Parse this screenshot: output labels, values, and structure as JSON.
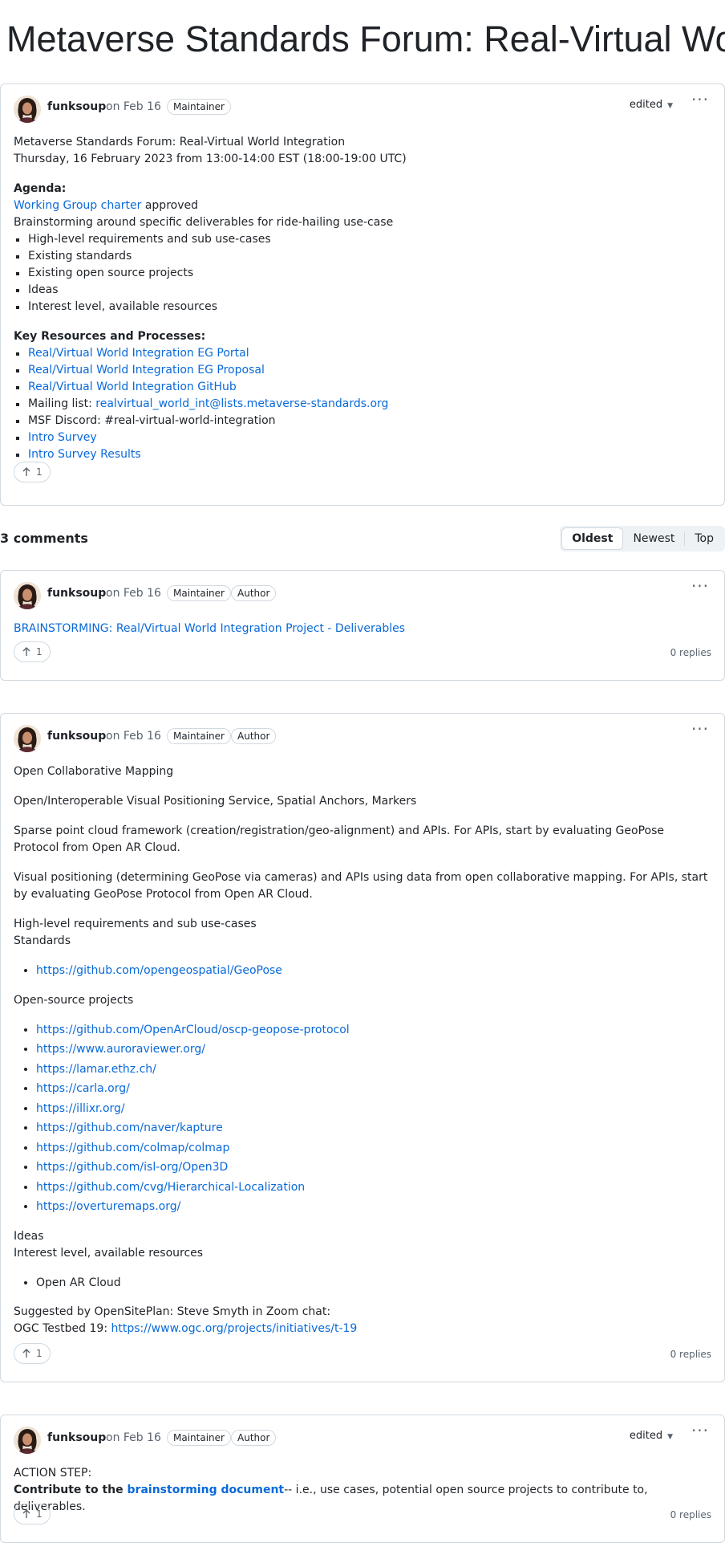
{
  "page_title": "Metaverse Standards Forum: Real-Virtual World",
  "colors": {
    "link": "#0969da",
    "muted": "#59636e",
    "border": "#d1d9e0",
    "text": "#1f2328"
  },
  "icons": {
    "upvote": "arrow-up-icon",
    "menu": "kebab-horizontal-icon",
    "edited_menu": "triangle-down-icon"
  },
  "post": {
    "author": "funksoup",
    "date": "on Feb 16",
    "badges": [
      "Maintainer"
    ],
    "edited_label": "edited",
    "line1": "Metaverse Standards Forum: Real-Virtual World Integration",
    "line2": "Thursday, 16 February 2023 from 13:00-14:00 EST (18:00-19:00 UTC)",
    "agenda_heading": "Agenda:",
    "charter_link": "Working Group charter",
    "charter_suffix": " approved",
    "brainstorm_line": "Brainstorming around specific deliverables for ride-hailing use-case",
    "agenda_items": [
      "High-level requirements and sub use-cases",
      "Existing standards",
      "Existing open source projects",
      "Ideas",
      "Interest level, available resources"
    ],
    "resources_heading": "Key Resources and Processes:",
    "resource_portal": "Real/Virtual World Integration EG Portal",
    "resource_proposal": "Real/Virtual World Integration EG Proposal",
    "resource_github": "Real/Virtual World Integration GitHub",
    "mailing_label": "Mailing list: ",
    "mailing_address": "realvirtual_world_int@lists.metaverse-standards.org",
    "discord_text": "MSF Discord: #real-virtual-world-integration",
    "survey": "Intro Survey",
    "survey_results": "Intro Survey Results",
    "upvotes": "1"
  },
  "comments_header": {
    "count_label": "3 comments",
    "sort_options": [
      "Oldest",
      "Newest",
      "Top"
    ],
    "active_sort": "Oldest"
  },
  "comment1": {
    "author": "funksoup",
    "date": "on Feb 16",
    "badges": [
      "Maintainer",
      "Author"
    ],
    "link_text": "BRAINSTORMING: Real/Virtual World Integration Project - Deliverables",
    "upvotes": "1",
    "replies": "0 replies"
  },
  "comment2": {
    "author": "funksoup",
    "date": "on Feb 16",
    "badges": [
      "Maintainer",
      "Author"
    ],
    "p1": "Open Collaborative Mapping",
    "p2": "Open/Interoperable Visual Positioning Service, Spatial Anchors, Markers",
    "p3": "Sparse point cloud framework (creation/registration/geo-alignment) and APIs. For APIs, start by evaluating GeoPose Protocol from Open AR Cloud.",
    "p4": "Visual positioning (determining GeoPose via cameras) and APIs using data from open collaborative mapping. For APIs, start by evaluating GeoPose Protocol from Open AR Cloud.",
    "p5a": "High-level requirements and sub use-cases",
    "p5b": "Standards",
    "standards_links": [
      "https://github.com/opengeospatial/GeoPose"
    ],
    "oss_heading": "Open-source projects",
    "oss_links": [
      "https://github.com/OpenArCloud/oscp-geopose-protocol",
      "https://www.auroraviewer.org/",
      "https://lamar.ethz.ch/",
      "https://carla.org/",
      "https://illixr.org/",
      "https://github.com/naver/kapture",
      "https://github.com/colmap/colmap",
      "https://github.com/isl-org/Open3D",
      "https://github.com/cvg/Hierarchical-Localization",
      "https://overturemaps.org/"
    ],
    "ideas": "Ideas",
    "interest": "Interest level, available resources",
    "interest_items": [
      "Open AR Cloud"
    ],
    "suggested": "Suggested by OpenSitePlan: Steve Smyth in Zoom chat:",
    "testbed_label": "OGC Testbed 19: ",
    "testbed_link": "https://www.ogc.org/projects/initiatives/t-19",
    "upvotes": "1",
    "replies": "0 replies"
  },
  "comment3": {
    "author": "funksoup",
    "date": "on Feb 16",
    "badges": [
      "Maintainer",
      "Author"
    ],
    "edited_label": "edited",
    "action_label": "ACTION STEP:",
    "bold_prefix": "Contribute to the ",
    "bold_link": "brainstorming document",
    "suffix": "-- i.e., use cases, potential open source projects to contribute to, deliverables.",
    "upvotes": "1",
    "replies": "0 replies"
  }
}
